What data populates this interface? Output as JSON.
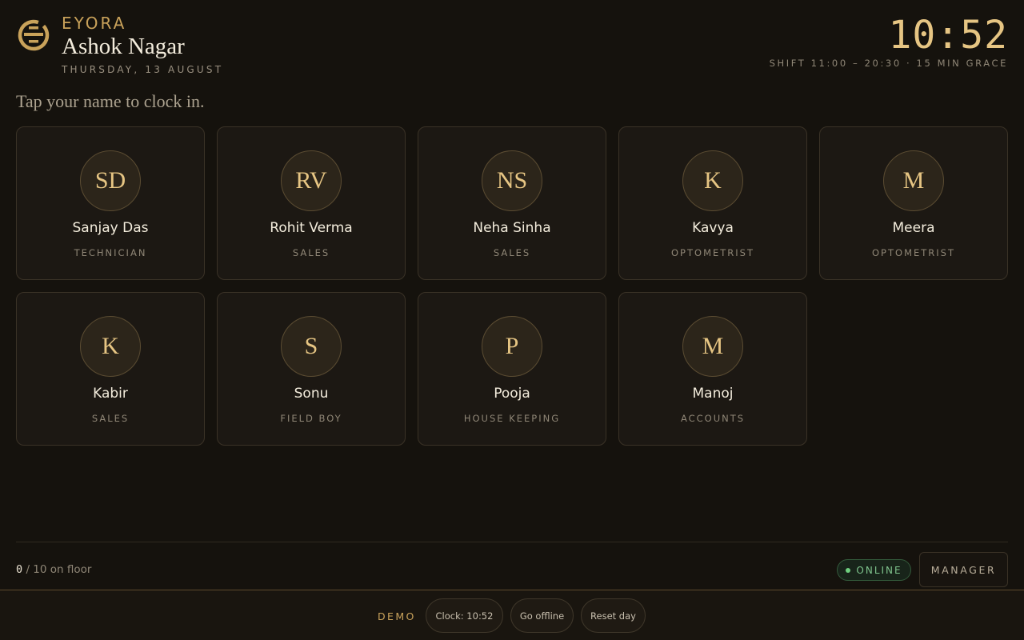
{
  "header": {
    "brand": "EYORA",
    "store": "Ashok Nagar",
    "date": "THURSDAY, 13 AUGUST",
    "clock": "10:52",
    "shift": "SHIFT 11:00 – 20:30 · 15 MIN GRACE"
  },
  "prompt": "Tap your name to clock in.",
  "staff": [
    {
      "initials": "SD",
      "name": "Sanjay Das",
      "role": "TECHNICIAN"
    },
    {
      "initials": "RV",
      "name": "Rohit Verma",
      "role": "SALES"
    },
    {
      "initials": "NS",
      "name": "Neha Sinha",
      "role": "SALES"
    },
    {
      "initials": "K",
      "name": "Kavya",
      "role": "OPTOMETRIST"
    },
    {
      "initials": "M",
      "name": "Meera",
      "role": "OPTOMETRIST"
    },
    {
      "initials": "K",
      "name": "Kabir",
      "role": "SALES"
    },
    {
      "initials": "S",
      "name": "Sonu",
      "role": "FIELD BOY"
    },
    {
      "initials": "P",
      "name": "Pooja",
      "role": "HOUSE KEEPING"
    },
    {
      "initials": "M",
      "name": "Manoj",
      "role": "ACCOUNTS"
    }
  ],
  "footer": {
    "floor_count": "0",
    "floor_total": "/ 10 on floor",
    "status": "ONLINE",
    "manager": "MANAGER"
  },
  "demo": {
    "label": "DEMO",
    "clock_button": "Clock: 10:52",
    "offline_button": "Go offline",
    "reset_button": "Reset day"
  },
  "colors": {
    "background": "#15120d",
    "accent_gold": "#e6c583",
    "online_green": "#6fcf7f"
  }
}
